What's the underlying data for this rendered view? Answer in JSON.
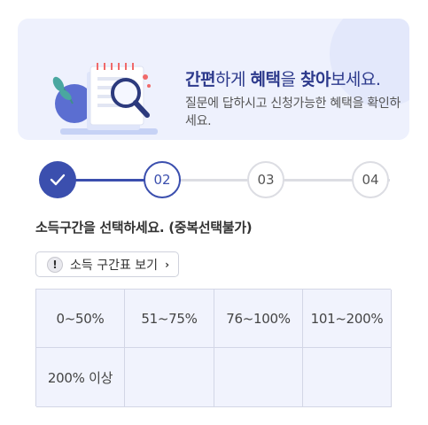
{
  "banner": {
    "title_part1": "간편",
    "title_part2": "하게 ",
    "title_part3": "혜택",
    "title_part4": "을 ",
    "title_part5": "찾아",
    "title_part6": "보세요.",
    "description": "질문에 답하시고 신청가능한 혜택을 확인하세요."
  },
  "stepper": {
    "steps": [
      {
        "label": "",
        "state": "done"
      },
      {
        "label": "02",
        "state": "active"
      },
      {
        "label": "03",
        "state": "todo"
      },
      {
        "label": "04",
        "state": "todo"
      }
    ]
  },
  "question": {
    "title": "소득구간을 선택하세요. (중복선택불가)"
  },
  "guide_button": {
    "label": "소득 구간표 보기",
    "icon": "exclamation-icon"
  },
  "options": [
    "0~50%",
    "51~75%",
    "76~100%",
    "101~200%",
    "200% 이상",
    "",
    "",
    ""
  ],
  "colors": {
    "accent": "#3b4fae",
    "banner_bg": "#eef1fd",
    "cell_bg": "#f1f3fd"
  }
}
